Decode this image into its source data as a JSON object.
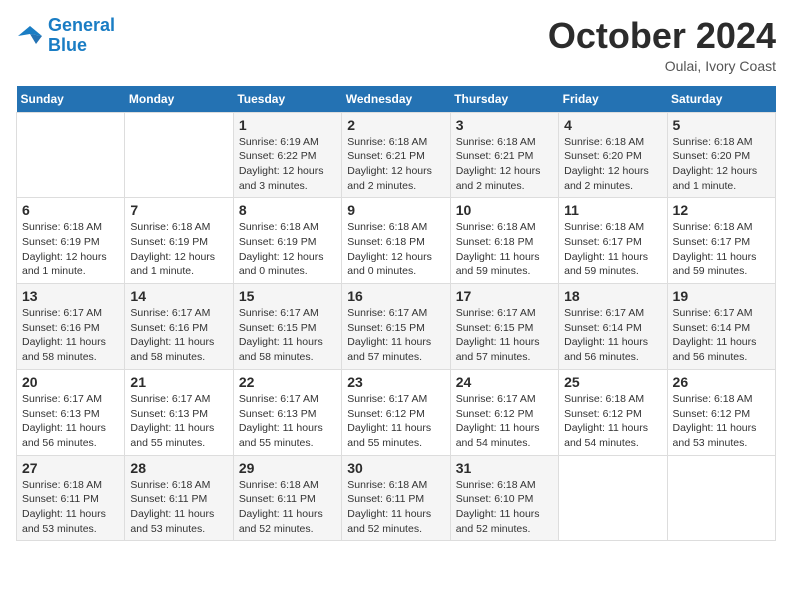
{
  "logo": {
    "line1": "General",
    "line2": "Blue"
  },
  "title": "October 2024",
  "subtitle": "Oulai, Ivory Coast",
  "days_of_week": [
    "Sunday",
    "Monday",
    "Tuesday",
    "Wednesday",
    "Thursday",
    "Friday",
    "Saturday"
  ],
  "weeks": [
    [
      {
        "day": "",
        "info": ""
      },
      {
        "day": "",
        "info": ""
      },
      {
        "day": "1",
        "info": "Sunrise: 6:19 AM\nSunset: 6:22 PM\nDaylight: 12 hours\nand 3 minutes."
      },
      {
        "day": "2",
        "info": "Sunrise: 6:18 AM\nSunset: 6:21 PM\nDaylight: 12 hours\nand 2 minutes."
      },
      {
        "day": "3",
        "info": "Sunrise: 6:18 AM\nSunset: 6:21 PM\nDaylight: 12 hours\nand 2 minutes."
      },
      {
        "day": "4",
        "info": "Sunrise: 6:18 AM\nSunset: 6:20 PM\nDaylight: 12 hours\nand 2 minutes."
      },
      {
        "day": "5",
        "info": "Sunrise: 6:18 AM\nSunset: 6:20 PM\nDaylight: 12 hours\nand 1 minute."
      }
    ],
    [
      {
        "day": "6",
        "info": "Sunrise: 6:18 AM\nSunset: 6:19 PM\nDaylight: 12 hours\nand 1 minute."
      },
      {
        "day": "7",
        "info": "Sunrise: 6:18 AM\nSunset: 6:19 PM\nDaylight: 12 hours\nand 1 minute."
      },
      {
        "day": "8",
        "info": "Sunrise: 6:18 AM\nSunset: 6:19 PM\nDaylight: 12 hours\nand 0 minutes."
      },
      {
        "day": "9",
        "info": "Sunrise: 6:18 AM\nSunset: 6:18 PM\nDaylight: 12 hours\nand 0 minutes."
      },
      {
        "day": "10",
        "info": "Sunrise: 6:18 AM\nSunset: 6:18 PM\nDaylight: 11 hours\nand 59 minutes."
      },
      {
        "day": "11",
        "info": "Sunrise: 6:18 AM\nSunset: 6:17 PM\nDaylight: 11 hours\nand 59 minutes."
      },
      {
        "day": "12",
        "info": "Sunrise: 6:18 AM\nSunset: 6:17 PM\nDaylight: 11 hours\nand 59 minutes."
      }
    ],
    [
      {
        "day": "13",
        "info": "Sunrise: 6:17 AM\nSunset: 6:16 PM\nDaylight: 11 hours\nand 58 minutes."
      },
      {
        "day": "14",
        "info": "Sunrise: 6:17 AM\nSunset: 6:16 PM\nDaylight: 11 hours\nand 58 minutes."
      },
      {
        "day": "15",
        "info": "Sunrise: 6:17 AM\nSunset: 6:15 PM\nDaylight: 11 hours\nand 58 minutes."
      },
      {
        "day": "16",
        "info": "Sunrise: 6:17 AM\nSunset: 6:15 PM\nDaylight: 11 hours\nand 57 minutes."
      },
      {
        "day": "17",
        "info": "Sunrise: 6:17 AM\nSunset: 6:15 PM\nDaylight: 11 hours\nand 57 minutes."
      },
      {
        "day": "18",
        "info": "Sunrise: 6:17 AM\nSunset: 6:14 PM\nDaylight: 11 hours\nand 56 minutes."
      },
      {
        "day": "19",
        "info": "Sunrise: 6:17 AM\nSunset: 6:14 PM\nDaylight: 11 hours\nand 56 minutes."
      }
    ],
    [
      {
        "day": "20",
        "info": "Sunrise: 6:17 AM\nSunset: 6:13 PM\nDaylight: 11 hours\nand 56 minutes."
      },
      {
        "day": "21",
        "info": "Sunrise: 6:17 AM\nSunset: 6:13 PM\nDaylight: 11 hours\nand 55 minutes."
      },
      {
        "day": "22",
        "info": "Sunrise: 6:17 AM\nSunset: 6:13 PM\nDaylight: 11 hours\nand 55 minutes."
      },
      {
        "day": "23",
        "info": "Sunrise: 6:17 AM\nSunset: 6:12 PM\nDaylight: 11 hours\nand 55 minutes."
      },
      {
        "day": "24",
        "info": "Sunrise: 6:17 AM\nSunset: 6:12 PM\nDaylight: 11 hours\nand 54 minutes."
      },
      {
        "day": "25",
        "info": "Sunrise: 6:18 AM\nSunset: 6:12 PM\nDaylight: 11 hours\nand 54 minutes."
      },
      {
        "day": "26",
        "info": "Sunrise: 6:18 AM\nSunset: 6:12 PM\nDaylight: 11 hours\nand 53 minutes."
      }
    ],
    [
      {
        "day": "27",
        "info": "Sunrise: 6:18 AM\nSunset: 6:11 PM\nDaylight: 11 hours\nand 53 minutes."
      },
      {
        "day": "28",
        "info": "Sunrise: 6:18 AM\nSunset: 6:11 PM\nDaylight: 11 hours\nand 53 minutes."
      },
      {
        "day": "29",
        "info": "Sunrise: 6:18 AM\nSunset: 6:11 PM\nDaylight: 11 hours\nand 52 minutes."
      },
      {
        "day": "30",
        "info": "Sunrise: 6:18 AM\nSunset: 6:11 PM\nDaylight: 11 hours\nand 52 minutes."
      },
      {
        "day": "31",
        "info": "Sunrise: 6:18 AM\nSunset: 6:10 PM\nDaylight: 11 hours\nand 52 minutes."
      },
      {
        "day": "",
        "info": ""
      },
      {
        "day": "",
        "info": ""
      }
    ]
  ]
}
